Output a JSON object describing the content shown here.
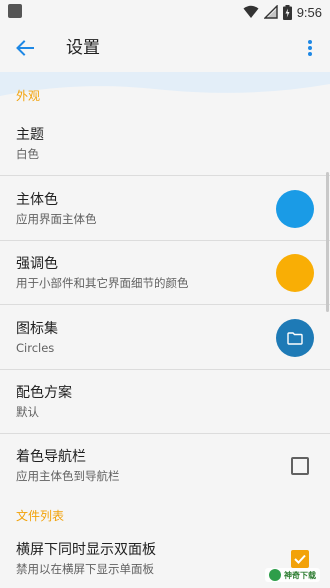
{
  "status_bar": {
    "time": "9:56",
    "battery_icon": "battery-charging-icon",
    "wifi_icon": "wifi-icon",
    "signal_icon": "signal-icon"
  },
  "app_bar": {
    "title": "设置",
    "back_icon": "arrow-back-icon",
    "more_icon": "more-vert-icon",
    "accent_color": "#1e88e5"
  },
  "sections": [
    {
      "header": "外观",
      "items": [
        {
          "title": "主题",
          "subtitle": "白色"
        },
        {
          "title": "主体色",
          "subtitle": "应用界面主体色",
          "swatch_color": "#1a9be6"
        },
        {
          "title": "强调色",
          "subtitle": "用于小部件和其它界面细节的颜色",
          "swatch_color": "#f9ae05"
        },
        {
          "title": "图标集",
          "subtitle": "Circles",
          "swatch_color": "#1e7ab6",
          "swatch_icon": "folder-icon"
        },
        {
          "title": "配色方案",
          "subtitle": "默认"
        },
        {
          "title": "着色导航栏",
          "subtitle": "应用主体色到导航栏",
          "checked": false
        }
      ]
    },
    {
      "header": "文件列表",
      "items": [
        {
          "title": "横屏下同时显示双面板",
          "subtitle": "禁用以在横屏下显示单面板",
          "checked": true
        }
      ]
    }
  ],
  "watermark": {
    "text": "神奇下载"
  },
  "colors": {
    "background": "#f5f5f5",
    "accent": "#f2a20a",
    "divider": "#dcdcdc"
  }
}
